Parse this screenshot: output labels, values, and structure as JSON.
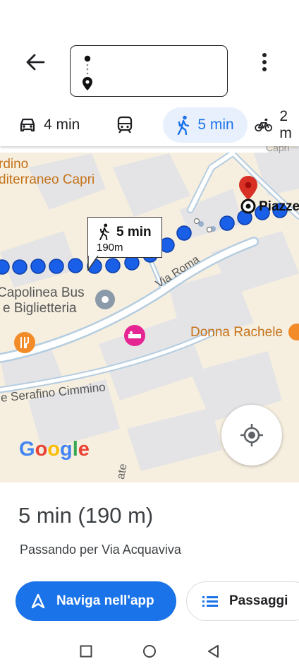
{
  "header": {
    "back_icon": "arrow-left-icon",
    "more_icon": "more-vert-icon",
    "origin_icon": "origin-dot-icon",
    "destination_icon": "destination-pin-icon"
  },
  "modes": [
    {
      "icon": "car-icon",
      "label": "4 min"
    },
    {
      "icon": "train-icon",
      "label": ""
    },
    {
      "icon": "walk-icon",
      "label": "5 min",
      "selected": true
    },
    {
      "icon": "bike-icon",
      "label": "2 m"
    }
  ],
  "map": {
    "labels": {
      "giardino": "rdino",
      "mediterraneo": "diterraneo Capri",
      "capri_top": "Capri",
      "piazzetta": "Piazze",
      "capolinea": "Capolinea Bus",
      "biglietteria": "e Biglietteria",
      "via_roma": "Via Roma",
      "donna_rachele": "Donna Rachele",
      "serafino": "e Serafino Cimmino",
      "ate": "ate"
    },
    "callout": {
      "time": "5 min",
      "distance": "190m"
    },
    "google": [
      "G",
      "o",
      "o",
      "g",
      "l",
      "e"
    ],
    "colors": {
      "route": "#1a5fe8",
      "pin": "#d93025",
      "road": "#a9c4d9",
      "bg": "#f6efe0"
    }
  },
  "summary": {
    "time_distance": "5 min (190 m)",
    "via": "Passando per Via Acquaviva"
  },
  "buttons": {
    "navigate": "Naviga nell'app",
    "steps": "Passaggi"
  },
  "system_nav": {
    "recents": "square-icon",
    "home": "circle-icon",
    "back": "triangle-back-icon"
  }
}
